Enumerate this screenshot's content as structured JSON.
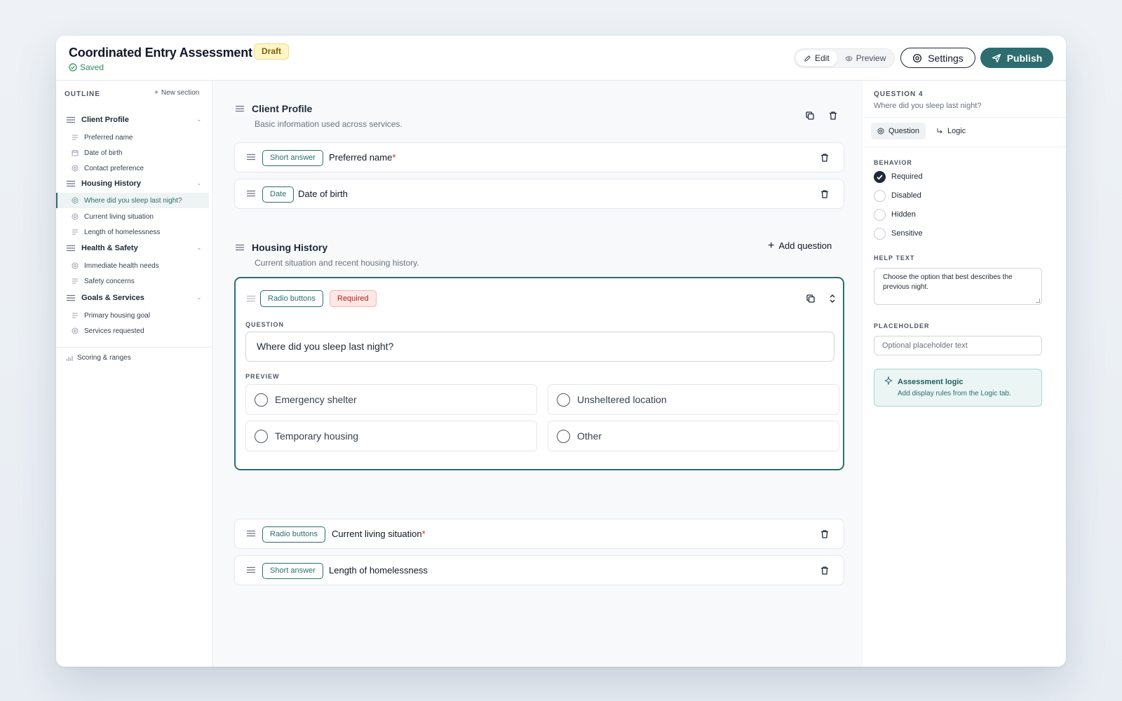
{
  "header": {
    "title": "Coordinated Entry Assessment",
    "status_badge": "Draft",
    "saved_label": "Saved",
    "mode_edit": "Edit",
    "mode_preview": "Preview",
    "settings_label": "Settings",
    "publish_label": "Publish"
  },
  "sidebar": {
    "heading": "OUTLINE",
    "new_section": "New section",
    "groups": [
      {
        "title": "Client Profile",
        "items": [
          {
            "label": "Preferred name",
            "icon": "text-lines-icon"
          },
          {
            "label": "Date of birth",
            "icon": "calendar-icon"
          },
          {
            "label": "Contact preference",
            "icon": "radio-icon"
          }
        ]
      },
      {
        "title": "Housing History",
        "items": [
          {
            "label": "Where did you sleep last night?",
            "icon": "radio-icon",
            "active": true
          },
          {
            "label": "Current living situation",
            "icon": "radio-icon"
          },
          {
            "label": "Length of homelessness",
            "icon": "text-lines-icon"
          }
        ]
      },
      {
        "title": "Health & Safety",
        "items": [
          {
            "label": "Immediate health needs",
            "icon": "radio-icon"
          },
          {
            "label": "Safety concerns",
            "icon": "text-lines-icon"
          }
        ]
      },
      {
        "title": "Goals & Services",
        "items": [
          {
            "label": "Primary housing goal",
            "icon": "text-lines-icon"
          },
          {
            "label": "Services requested",
            "icon": "radio-icon"
          }
        ]
      }
    ],
    "scoring": "Scoring & ranges"
  },
  "main": {
    "sections": [
      {
        "title": "Client Profile",
        "description": "Basic information used across services."
      },
      {
        "title": "Housing History",
        "description": "Current situation and recent housing history."
      }
    ],
    "questions": [
      {
        "type": "Short answer",
        "title": "Preferred name",
        "required_mark": "*"
      },
      {
        "type": "Date",
        "title": "Date of birth",
        "required_mark": ""
      },
      {
        "type": "Radio buttons",
        "title": "Current living situation",
        "required_mark": "*"
      },
      {
        "type": "Short answer",
        "title": "Length of homelessness",
        "required_mark": ""
      }
    ],
    "add_question": "Add question",
    "active": {
      "type": "Radio buttons",
      "required_tag": "Required",
      "question_label": "QUESTION",
      "question_value": "Where did you sleep last night?",
      "preview_label": "PREVIEW",
      "options": [
        "Emergency shelter",
        "Unsheltered location",
        "Temporary housing",
        "Other"
      ]
    }
  },
  "panel": {
    "heading": "QUESTION 4",
    "subtitle": "Where did you sleep last night?",
    "tab_question": "Question",
    "tab_logic": "Logic",
    "behavior_label": "BEHAVIOR",
    "behaviors": [
      {
        "label": "Required",
        "checked": true
      },
      {
        "label": "Disabled",
        "checked": false
      },
      {
        "label": "Hidden",
        "checked": false
      },
      {
        "label": "Sensitive",
        "checked": false
      }
    ],
    "help_label": "HELP TEXT",
    "help_text": "Choose the option that best describes the previous night.",
    "placeholder_label": "PLACEHOLDER",
    "placeholder_hint": "Optional placeholder text",
    "logic_title": "Assessment logic",
    "logic_desc": "Add display rules from the Logic tab."
  },
  "colors": {
    "accent": "#2d6d6f",
    "draft": "#fef6c8",
    "required": "#fde8e6",
    "saved": "#2f8f5b"
  }
}
